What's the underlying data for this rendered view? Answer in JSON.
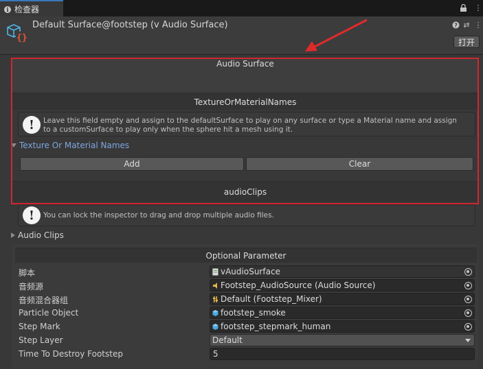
{
  "tab": {
    "title": "检查器"
  },
  "header": {
    "title": "Default Surface@footstep (v Audio Surface)",
    "open_button": "打开"
  },
  "sections": {
    "audio_surface": "Audio Surface",
    "texture_names_header": "TextureOrMaterialNames",
    "texture_help": "Leave this field empty and assign to the defaultSurface to play on any surface or type a Material name and assign to a customSurface to play only when the sphere hit a mesh using it.",
    "texture_foldout": "Texture Or Material Names",
    "add_button": "Add",
    "clear_button": "Clear",
    "audio_clips_header": "audioClips",
    "audio_help": "You can lock the inspector to drag and drop multiple audio files.",
    "audio_foldout": "Audio Clips",
    "optional_header": "Optional Parameter"
  },
  "properties": [
    {
      "label": "脚本",
      "value": "vAudioSurface",
      "icon": "script-icon"
    },
    {
      "label": "音频源",
      "value": "Footstep_AudioSource (Audio Source)",
      "icon": "speaker-icon"
    },
    {
      "label": "音频混合器组",
      "value": "Default (Footstep_Mixer)",
      "icon": "mixer-icon"
    },
    {
      "label": "Particle Object",
      "value": "footstep_smoke",
      "icon": "prefab-cube-icon"
    },
    {
      "label": "Step Mark",
      "value": "footstep_stepmark_human",
      "icon": "prefab-cube-icon"
    },
    {
      "label": "Step Layer",
      "value": "Default",
      "icon": "dropdown-arrow-icon"
    },
    {
      "label": "Time To Destroy Footstep",
      "value": "5"
    }
  ],
  "colors": {
    "highlight_box": "#d22630",
    "annotation_arrow": "#e02a2a",
    "foldout_blue": "#7ea6e0"
  }
}
